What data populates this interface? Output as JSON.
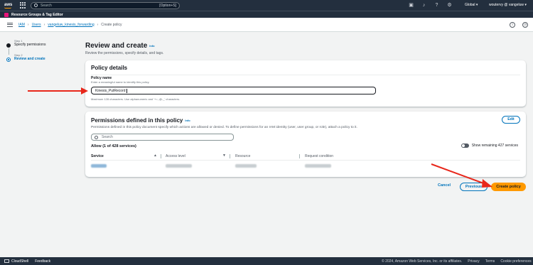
{
  "topnav": {
    "logo": "aws",
    "search_placeholder": "Search",
    "search_shortcut": "[Option+S]",
    "region": "Global",
    "account": "woutervy @ vangeluw",
    "icons": [
      "cloudshell-icon",
      "bell-icon",
      "help-icon",
      "gear-icon"
    ]
  },
  "subnav": {
    "label": "Resource Groups & Tag Editor"
  },
  "breadcrumb": {
    "items": [
      "IAM",
      "Users",
      "vangeluw_kinesis_forwarding"
    ],
    "current": "Create policy"
  },
  "steps": [
    {
      "small": "Step 1",
      "title": "Specify permissions"
    },
    {
      "small": "Step 2",
      "title": "Review and create"
    }
  ],
  "page": {
    "title": "Review and create",
    "info": "Info",
    "subtitle": "Review the permissions, specify details, and tags."
  },
  "policy_details": {
    "title": "Policy details",
    "name_label": "Policy name",
    "name_desc": "Enter a meaningful name to identify this policy.",
    "name_value": "Kinesis_PutRecord",
    "name_note": "Maximum 128 characters. Use alphanumeric and '+=,.@-_' characters."
  },
  "permissions": {
    "title": "Permissions defined in this policy",
    "info": "Info",
    "desc": "Permissions defined in this policy document specify which actions are allowed or denied. To define permissions for an IAM identity (user, user group, or role), attach a policy to it.",
    "edit_label": "Edit",
    "search_placeholder": "Search",
    "allow_title": "Allow (1 of 428 services)",
    "toggle_label": "Show remaining 427 services",
    "columns": [
      "Service",
      "Access level",
      "Resource",
      "Request condition"
    ]
  },
  "actions": {
    "cancel": "Cancel",
    "previous": "Previous",
    "create": "Create policy"
  },
  "footer": {
    "cloudshell": "CloudShell",
    "feedback": "Feedback",
    "copyright": "© 2024, Amazon Web Services, Inc. or its affiliates.",
    "privacy": "Privacy",
    "terms": "Terms",
    "cookies": "Cookie preferences"
  },
  "colors": {
    "nav_bg": "#232f3e",
    "link": "#0073bb",
    "primary_button": "#ff9900",
    "annotation_arrow": "#e8271b"
  }
}
